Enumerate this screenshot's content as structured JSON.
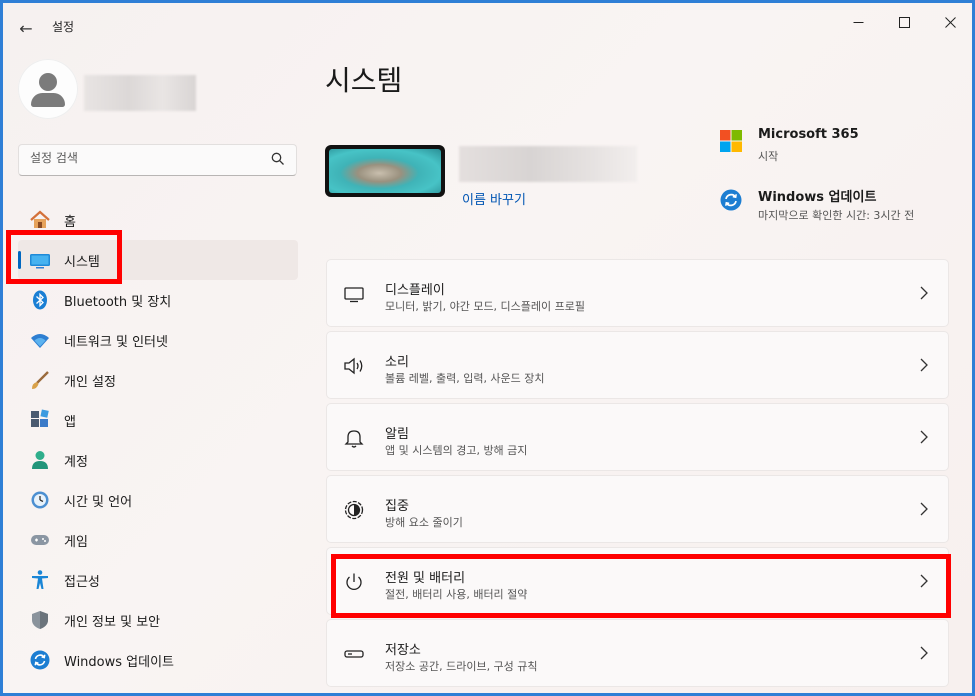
{
  "window": {
    "title": "설정",
    "back_glyph": "←",
    "minimize_glyph": "—",
    "maximize_glyph": "☐",
    "close_glyph": "✕"
  },
  "user": {
    "avatar_icon": "person-icon"
  },
  "search": {
    "placeholder": "설정 검색",
    "icon": "search-icon"
  },
  "sidebar": {
    "items": [
      {
        "label": "홈",
        "icon": "home-icon",
        "active": false
      },
      {
        "label": "시스템",
        "icon": "system-icon",
        "active": true
      },
      {
        "label": "Bluetooth 및 장치",
        "icon": "bluetooth-icon",
        "active": false
      },
      {
        "label": "네트워크 및 인터넷",
        "icon": "wifi-icon",
        "active": false
      },
      {
        "label": "개인 설정",
        "icon": "brush-icon",
        "active": false
      },
      {
        "label": "앱",
        "icon": "apps-icon",
        "active": false
      },
      {
        "label": "계정",
        "icon": "account-icon",
        "active": false
      },
      {
        "label": "시간 및 언어",
        "icon": "clock-globe-icon",
        "active": false
      },
      {
        "label": "게임",
        "icon": "gamepad-icon",
        "active": false
      },
      {
        "label": "접근성",
        "icon": "accessibility-icon",
        "active": false
      },
      {
        "label": "개인 정보 및 보안",
        "icon": "shield-icon",
        "active": false
      },
      {
        "label": "Windows 업데이트",
        "icon": "update-icon",
        "active": false
      }
    ]
  },
  "main": {
    "title": "시스템",
    "device": {
      "rename_label": "이름 바꾸기"
    },
    "quick_links": [
      {
        "title": "Microsoft 365",
        "subtitle": "시작",
        "icon": "microsoft-logo-icon"
      },
      {
        "title": "Windows 업데이트",
        "subtitle": "마지막으로 확인한 시간: 3시간 전",
        "icon": "update-icon"
      }
    ],
    "cards": [
      {
        "title": "디스플레이",
        "subtitle": "모니터, 밝기, 야간 모드, 디스플레이 프로필",
        "icon": "display-icon"
      },
      {
        "title": "소리",
        "subtitle": "볼륨 레벨, 출력, 입력, 사운드 장치",
        "icon": "speaker-icon"
      },
      {
        "title": "알림",
        "subtitle": "앱 및 시스템의 경고, 방해 금지",
        "icon": "bell-icon"
      },
      {
        "title": "집중",
        "subtitle": "방해 요소 줄이기",
        "icon": "focus-icon"
      },
      {
        "title": "전원 및 배터리",
        "subtitle": "절전, 배터리 사용, 배터리 절약",
        "icon": "power-icon"
      },
      {
        "title": "저장소",
        "subtitle": "저장소 공간, 드라이브, 구성 규칙",
        "icon": "storage-icon"
      }
    ]
  },
  "colors": {
    "accent": "#0067c0",
    "highlight_box": "#ff0000",
    "window_border": "#2f7fd6"
  }
}
